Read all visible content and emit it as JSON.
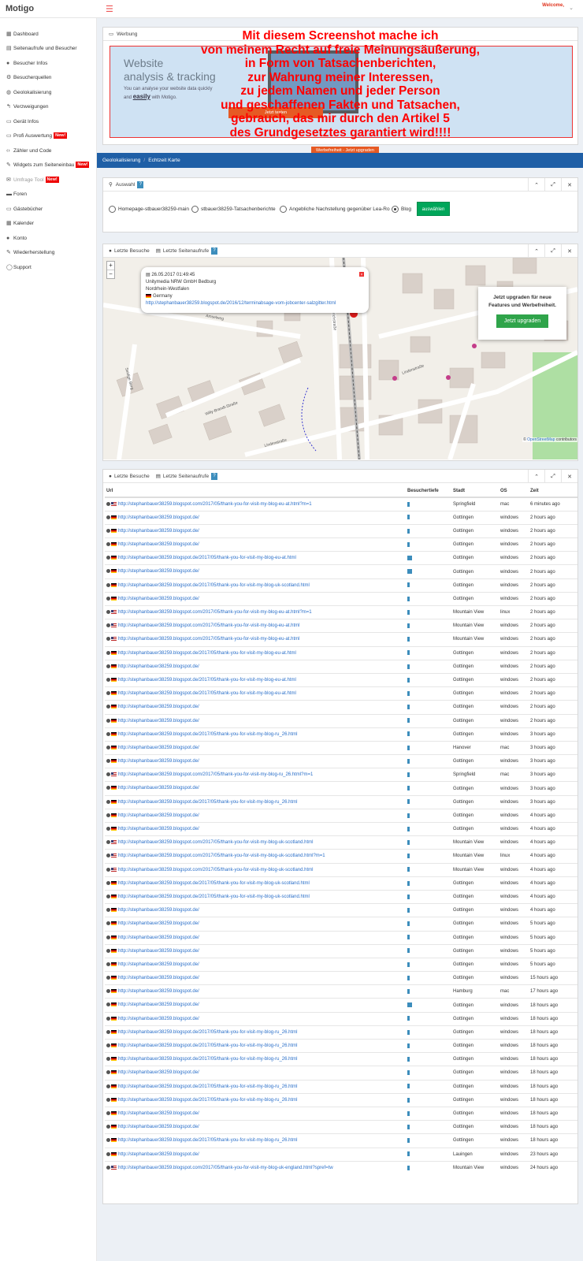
{
  "header": {
    "logo": "Motigo",
    "welcome": "Welcome,"
  },
  "sidebar": {
    "items": [
      {
        "icon": "▦",
        "label": "Dashboard"
      },
      {
        "icon": "▤",
        "label": "Seitenaufrufe und Besucher"
      },
      {
        "icon": "●",
        "label": "Besucher Infos"
      },
      {
        "icon": "⚙",
        "label": "Besucherquellen"
      },
      {
        "icon": "◍",
        "label": "Geolokalisierung"
      },
      {
        "icon": "↰",
        "label": "Verzweigungen"
      },
      {
        "icon": "▭",
        "label": "Gerät Infos"
      },
      {
        "icon": "▭",
        "label": "Profi Auswertung",
        "badge": "New!"
      },
      {
        "icon": "‹›",
        "label": "Zähler und Code"
      },
      {
        "icon": "✎",
        "label": "Widgets zum Seiteneinbau",
        "badge": "New!"
      },
      {
        "icon": "✉",
        "label": "Umfrage Tool",
        "badge": "New!",
        "disabled": true
      },
      {
        "icon": "▬",
        "label": "Foren"
      },
      {
        "icon": "▭",
        "label": "Gästebücher"
      },
      {
        "icon": "▦",
        "label": "Kalender"
      },
      {
        "icon": "●",
        "label": "Konto"
      },
      {
        "icon": "✎",
        "label": "Wiederherstellung"
      },
      {
        "icon": "◯",
        "label": "Support"
      }
    ]
  },
  "ad": {
    "header": "Werbung",
    "line1": "Website",
    "line2": "analysis & tracking",
    "line3": "You can analyse your website data quickly",
    "line4a": "and ",
    "line4b": "easily",
    "line4c": " with Motigo.",
    "button": "Jetzt testen",
    "upgrade": "Werbefreiheit - Jetzt upgraden"
  },
  "overlay": [
    "Mit diesem Screenshot mache ich",
    "von meinem Recht auf freie Meinungsäußerung,",
    "in Form von Tatsachenberichten,",
    "zur Wahrung meiner Interessen,",
    "zu jedem Namen und jeder Person",
    "und geschaffenen Fakten und Tatsachen,",
    "gebrauch, das mir durch den Artikel 5",
    "des Grundgesetztes garantiert wird!!!!"
  ],
  "breadcrumb": {
    "parent": "Geolokalisierung",
    "sep": "/",
    "current": "Echtzeit Karte"
  },
  "selection": {
    "title": "Auswahl",
    "q": "?",
    "options": [
      "Homepage-stbauer38259-main",
      "stbauer38259-Tatsachenberichte",
      "Angebliche Nachstellung gegenüber Lea-Ro",
      "Blog"
    ],
    "selected": 3,
    "button": "auswählen"
  },
  "mapbox": {
    "tab1": "Letzte Besuche",
    "tab2": "Letzte Seitenaufrufe",
    "q": "?"
  },
  "popup": {
    "date": "26.05.2017 01:49:45",
    "org": "Unitymedia NRW GmbH Bedburg",
    "region": "Nordrhein-Westfalen",
    "country": "Germany",
    "url": "http://stephanbauer38259.blogspot.de/2016/12/terminabsage-vom-jobcenter-salzgitter.html"
  },
  "upgrade_card": {
    "text1": "Jetzt upgraden für neue",
    "text2": "Features und Werbefreiheit.",
    "button": "Jetzt upgraden"
  },
  "attribution": {
    "prefix": "© ",
    "link": "OpenStreetMap",
    "suffix": " contributors"
  },
  "streets": [
    "Willy-Brandt-Straße",
    "Lindenstraße",
    "Heinrichstraße",
    "Lindenstraße",
    "Seidige Berg",
    "Amselweg"
  ],
  "table": {
    "tab1": "Letzte Besuche",
    "tab2": "Letzte Seitenaufrufe",
    "q": "?",
    "headers": [
      "Url",
      "Besuchertiefe",
      "Stadt",
      "OS",
      "Zeit"
    ],
    "rows": [
      [
        "us",
        "http://stephanbauer38259.blogspot.com/2017/05/thank-you-for-visit-my-blog-eu-at.html?m=1",
        "n",
        "Springfield",
        "mac",
        "6 minutes ago"
      ],
      [
        "de",
        "http://stephanbauer38259.blogspot.de/",
        "n",
        "Gottingen",
        "windows",
        "2 hours ago"
      ],
      [
        "de",
        "http://stephanbauer38259.blogspot.de/",
        "n",
        "Gottingen",
        "windows",
        "2 hours ago"
      ],
      [
        "de",
        "http://stephanbauer38259.blogspot.de/",
        "n",
        "Gottingen",
        "windows",
        "2 hours ago"
      ],
      [
        "de",
        "http://stephanbauer38259.blogspot.de/2017/05/thank-you-for-visit-my-blog-eu-at.html",
        "w",
        "Gottingen",
        "windows",
        "2 hours ago"
      ],
      [
        "de",
        "http://stephanbauer38259.blogspot.de/",
        "w",
        "Gottingen",
        "windows",
        "2 hours ago"
      ],
      [
        "de",
        "http://stephanbauer38259.blogspot.de/2017/05/thank-you-for-visit-my-blog-uk-scotland.html",
        "n",
        "Gottingen",
        "windows",
        "2 hours ago"
      ],
      [
        "de",
        "http://stephanbauer38259.blogspot.de/",
        "n",
        "Gottingen",
        "windows",
        "2 hours ago"
      ],
      [
        "us",
        "http://stephanbauer38259.blogspot.com/2017/05/thank-you-for-visit-my-blog-eu-at.html?m=1",
        "n",
        "Mountain View",
        "linux",
        "2 hours ago"
      ],
      [
        "us",
        "http://stephanbauer38259.blogspot.com/2017/05/thank-you-for-visit-my-blog-eu-at.html",
        "n",
        "Mountain View",
        "windows",
        "2 hours ago"
      ],
      [
        "us",
        "http://stephanbauer38259.blogspot.com/2017/05/thank-you-for-visit-my-blog-eu-at.html",
        "n",
        "Mountain View",
        "windows",
        "2 hours ago"
      ],
      [
        "de",
        "http://stephanbauer38259.blogspot.de/2017/05/thank-you-for-visit-my-blog-eu-at.html",
        "n",
        "Gottingen",
        "windows",
        "2 hours ago"
      ],
      [
        "de",
        "http://stephanbauer38259.blogspot.de/",
        "n",
        "Gottingen",
        "windows",
        "2 hours ago"
      ],
      [
        "de",
        "http://stephanbauer38259.blogspot.de/2017/05/thank-you-for-visit-my-blog-eu-at.html",
        "n",
        "Gottingen",
        "windows",
        "2 hours ago"
      ],
      [
        "de",
        "http://stephanbauer38259.blogspot.de/2017/05/thank-you-for-visit-my-blog-eu-at.html",
        "n",
        "Gottingen",
        "windows",
        "2 hours ago"
      ],
      [
        "de",
        "http://stephanbauer38259.blogspot.de/",
        "n",
        "Gottingen",
        "windows",
        "2 hours ago"
      ],
      [
        "de",
        "http://stephanbauer38259.blogspot.de/",
        "n",
        "Gottingen",
        "windows",
        "2 hours ago"
      ],
      [
        "de",
        "http://stephanbauer38259.blogspot.de/2017/05/thank-you-for-visit-my-blog-ru_26.html",
        "n",
        "Gottingen",
        "windows",
        "3 hours ago"
      ],
      [
        "de",
        "http://stephanbauer38259.blogspot.de/",
        "n",
        "Hanover",
        "mac",
        "3 hours ago"
      ],
      [
        "de",
        "http://stephanbauer38259.blogspot.de/",
        "n",
        "Gottingen",
        "windows",
        "3 hours ago"
      ],
      [
        "us",
        "http://stephanbauer38259.blogspot.com/2017/05/thank-you-for-visit-my-blog-ru_26.html?m=1",
        "n",
        "Springfield",
        "mac",
        "3 hours ago"
      ],
      [
        "de",
        "http://stephanbauer38259.blogspot.de/",
        "n",
        "Gottingen",
        "windows",
        "3 hours ago"
      ],
      [
        "de",
        "http://stephanbauer38259.blogspot.de/2017/05/thank-you-for-visit-my-blog-ru_26.html",
        "n",
        "Gottingen",
        "windows",
        "3 hours ago"
      ],
      [
        "de",
        "http://stephanbauer38259.blogspot.de/",
        "n",
        "Gottingen",
        "windows",
        "4 hours ago"
      ],
      [
        "de",
        "http://stephanbauer38259.blogspot.de/",
        "n",
        "Gottingen",
        "windows",
        "4 hours ago"
      ],
      [
        "us",
        "http://stephanbauer38259.blogspot.com/2017/05/thank-you-for-visit-my-blog-uk-scotland.html",
        "n",
        "Mountain View",
        "windows",
        "4 hours ago"
      ],
      [
        "us",
        "http://stephanbauer38259.blogspot.com/2017/05/thank-you-for-visit-my-blog-uk-scotland.html?m=1",
        "n",
        "Mountain View",
        "linux",
        "4 hours ago"
      ],
      [
        "us",
        "http://stephanbauer38259.blogspot.com/2017/05/thank-you-for-visit-my-blog-uk-scotland.html",
        "n",
        "Mountain View",
        "windows",
        "4 hours ago"
      ],
      [
        "de",
        "http://stephanbauer38259.blogspot.de/2017/05/thank-you-for-visit-my-blog-uk-scotland.html",
        "n",
        "Gottingen",
        "windows",
        "4 hours ago"
      ],
      [
        "de",
        "http://stephanbauer38259.blogspot.de/2017/05/thank-you-for-visit-my-blog-uk-scotland.html",
        "n",
        "Gottingen",
        "windows",
        "4 hours ago"
      ],
      [
        "de",
        "http://stephanbauer38259.blogspot.de/",
        "n",
        "Gottingen",
        "windows",
        "4 hours ago"
      ],
      [
        "de",
        "http://stephanbauer38259.blogspot.de/",
        "n",
        "Gottingen",
        "windows",
        "5 hours ago"
      ],
      [
        "de",
        "http://stephanbauer38259.blogspot.de/",
        "n",
        "Gottingen",
        "windows",
        "5 hours ago"
      ],
      [
        "de",
        "http://stephanbauer38259.blogspot.de/",
        "n",
        "Gottingen",
        "windows",
        "5 hours ago"
      ],
      [
        "de",
        "http://stephanbauer38259.blogspot.de/",
        "n",
        "Gottingen",
        "windows",
        "5 hours ago"
      ],
      [
        "de",
        "http://stephanbauer38259.blogspot.de/",
        "n",
        "Gottingen",
        "windows",
        "15 hours ago"
      ],
      [
        "de",
        "http://stephanbauer38259.blogspot.de/",
        "n",
        "Hamburg",
        "mac",
        "17 hours ago"
      ],
      [
        "de",
        "http://stephanbauer38259.blogspot.de/",
        "w",
        "Gottingen",
        "windows",
        "18 hours ago"
      ],
      [
        "de",
        "http://stephanbauer38259.blogspot.de/",
        "n",
        "Gottingen",
        "windows",
        "18 hours ago"
      ],
      [
        "de",
        "http://stephanbauer38259.blogspot.de/2017/05/thank-you-for-visit-my-blog-ru_26.html",
        "n",
        "Gottingen",
        "windows",
        "18 hours ago"
      ],
      [
        "de",
        "http://stephanbauer38259.blogspot.de/2017/05/thank-you-for-visit-my-blog-ru_26.html",
        "n",
        "Gottingen",
        "windows",
        "18 hours ago"
      ],
      [
        "de",
        "http://stephanbauer38259.blogspot.de/2017/05/thank-you-for-visit-my-blog-ru_26.html",
        "n",
        "Gottingen",
        "windows",
        "18 hours ago"
      ],
      [
        "de",
        "http://stephanbauer38259.blogspot.de/",
        "n",
        "Gottingen",
        "windows",
        "18 hours ago"
      ],
      [
        "de",
        "http://stephanbauer38259.blogspot.de/2017/05/thank-you-for-visit-my-blog-ru_26.html",
        "n",
        "Gottingen",
        "windows",
        "18 hours ago"
      ],
      [
        "de",
        "http://stephanbauer38259.blogspot.de/2017/05/thank-you-for-visit-my-blog-ru_26.html",
        "n",
        "Gottingen",
        "windows",
        "18 hours ago"
      ],
      [
        "de",
        "http://stephanbauer38259.blogspot.de/",
        "n",
        "Gottingen",
        "windows",
        "18 hours ago"
      ],
      [
        "de",
        "http://stephanbauer38259.blogspot.de/",
        "n",
        "Gottingen",
        "windows",
        "18 hours ago"
      ],
      [
        "de",
        "http://stephanbauer38259.blogspot.de/2017/05/thank-you-for-visit-my-blog-ru_26.html",
        "n",
        "Gottingen",
        "windows",
        "18 hours ago"
      ],
      [
        "de",
        "http://stephanbauer38259.blogspot.de/",
        "n",
        "Lauingen",
        "windows",
        "23 hours ago"
      ],
      [
        "us",
        "http://stephanbauer38259.blogspot.com/2017/05/thank-you-for-visit-my-blog-uk-england.html?spref=tw",
        "n",
        "Mountain View",
        "windows",
        "24 hours ago"
      ]
    ]
  }
}
